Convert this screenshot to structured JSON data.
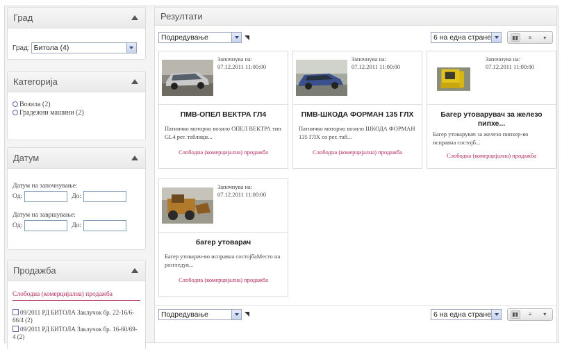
{
  "sidebar": {
    "city": {
      "title": "Град",
      "label": "Град:",
      "selected": "Битола (4)"
    },
    "category": {
      "title": "Категорија",
      "options": [
        "Возила (2)",
        "Градежни машини (2)"
      ]
    },
    "date": {
      "title": "Датум",
      "start_label": "Датум на започнување:",
      "end_label": "Датум на завршување:",
      "from": "Од:",
      "to": "До:"
    },
    "sale": {
      "title": "Продажба",
      "link": "Слободна (комерцијална) продажба",
      "items": [
        "09/2011 РД БИТОЛА Заклучок бр. 22-16/6-66/4 (2)",
        "09/2011 РД БИТОЛА Заклучок бр. 16-60/69-4 (2)"
      ]
    }
  },
  "main": {
    "title": "Резултати",
    "toolbar": {
      "sort_label": "Подредување",
      "per_page": "6 на една стране"
    },
    "cards": [
      {
        "start_label": "Започнува на:",
        "start_date": "07.12.2011 11:00:00",
        "title": "ПМВ-ОПЕЛ ВЕКТРА ГЛ4",
        "desc": "Патничко моторно возило ОПЕЛ ВЕКТРА тип GL4 рег. таблици...",
        "sale": "Слободна (комерцијална) продажба",
        "image": "car-photo"
      },
      {
        "start_label": "Започнува на:",
        "start_date": "07.12.2011 11:00:00",
        "title": "ПМВ-ШКОДА ФОРМАН 135 ГЛХ",
        "desc": "Патничко моторно возило ШКОДА ФОРМАН 135 ГЛХ со рег. таб...",
        "sale": "Слободна (комерцијална) продажба",
        "image": "car-photo"
      },
      {
        "start_label": "Започнува на:",
        "start_date": "07.12.2011 11:00:00",
        "title": "Багер утоварувач за железо пипхе...",
        "desc": "Багер утоварувач за железо пипхер-во исправна состојб...",
        "sale": "Слободна (комерцијална) продажба",
        "image": "excavator-photo"
      },
      {
        "start_label": "Започнува на:",
        "start_date": "07.12.2011 11:00:00",
        "title": "багер утоварач",
        "desc": "Багер утоварач-во исправна состојбаМесто на разгледув...",
        "sale": "Слободна (комерцијална) продажба",
        "image": "loader-photo"
      }
    ]
  }
}
